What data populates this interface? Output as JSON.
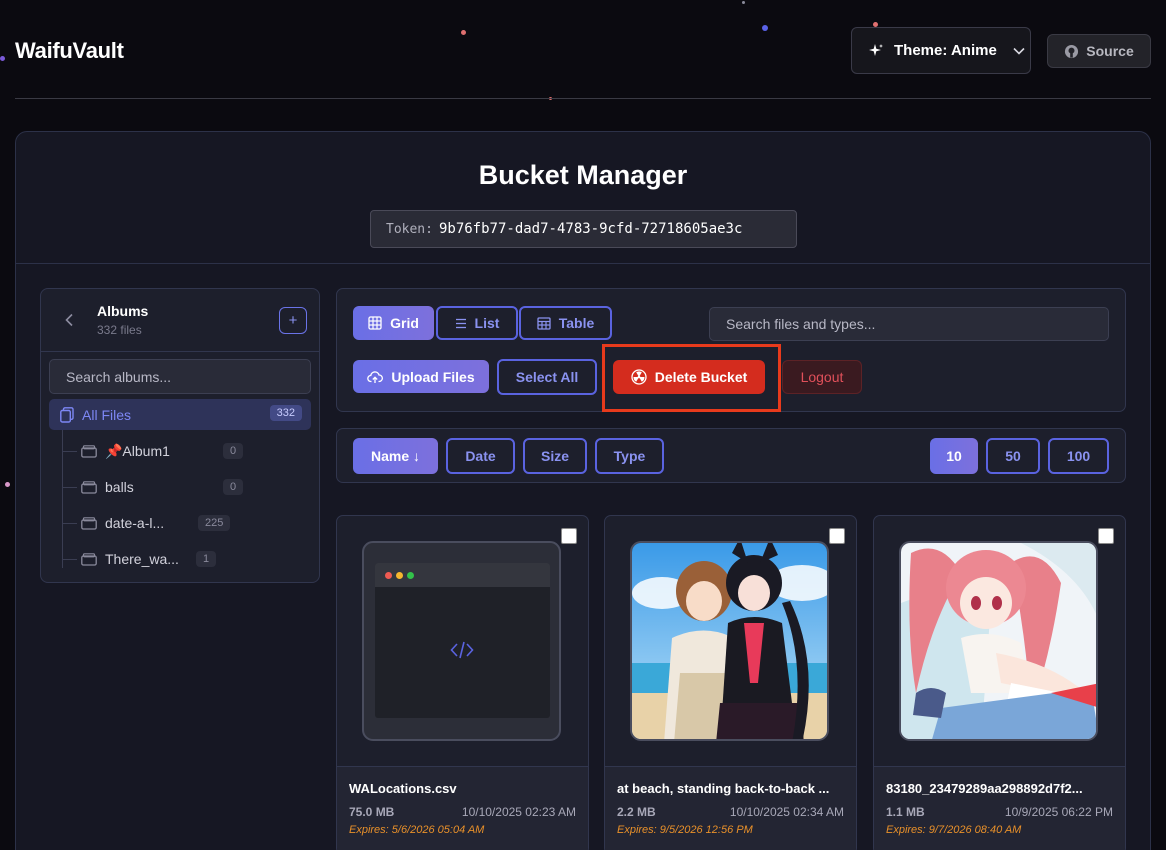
{
  "app": {
    "brand": "WaifuVault"
  },
  "header": {
    "theme_label": "Theme: Anime",
    "source_label": "Source"
  },
  "bucket": {
    "title": "Bucket Manager",
    "token_label": "Token:",
    "token_value": "9b76fb77-dad7-4783-9cfd-72718605ae3c"
  },
  "albums": {
    "title": "Albums",
    "count_text": "332 files",
    "add_symbol": "+",
    "search_placeholder": "Search albums...",
    "all_files": {
      "label": "All Files",
      "count": "332"
    },
    "items": [
      {
        "label": "📌Album1",
        "count": "0"
      },
      {
        "label": "balls",
        "count": "0"
      },
      {
        "label": "date-a-l...",
        "count": "225"
      },
      {
        "label": "There_wa...",
        "count": "1"
      }
    ]
  },
  "toolbar": {
    "views": {
      "grid": "Grid",
      "list": "List",
      "table": "Table"
    },
    "search_placeholder": "Search files and types...",
    "upload": "Upload Files",
    "select_all": "Select All",
    "delete_bucket": "Delete Bucket",
    "logout": "Logout"
  },
  "sort": {
    "name": "Name ↓",
    "date": "Date",
    "size": "Size",
    "type": "Type",
    "page_sizes": [
      "10",
      "50",
      "100"
    ]
  },
  "files": [
    {
      "name": "WALocations.csv",
      "size": "75.0 MB",
      "date": "10/10/2025 02:23 AM",
      "expires": "Expires: 5/6/2026 05:04 AM"
    },
    {
      "name": "at beach, standing back-to-back ...",
      "size": "2.2 MB",
      "date": "10/10/2025 02:34 AM",
      "expires": "Expires: 9/5/2026 12:56 PM"
    },
    {
      "name": "83180_23479289aa298892d7f2...",
      "size": "1.1 MB",
      "date": "10/9/2025 06:22 PM",
      "expires": "Expires: 9/7/2026 08:40 AM"
    }
  ],
  "colors": {
    "background": "#0b0a10",
    "accent": "#6a6fe6",
    "danger": "#d42c1e",
    "expires": "#e8902a",
    "highlight": "#e83a1c"
  },
  "icons": {
    "theme": "sparkle-icon",
    "source": "github-icon",
    "grid": "grid-icon",
    "list": "list-icon",
    "table": "table-icon",
    "upload": "cloud-upload-icon",
    "delete": "radiation-icon",
    "file": "code-icon"
  }
}
